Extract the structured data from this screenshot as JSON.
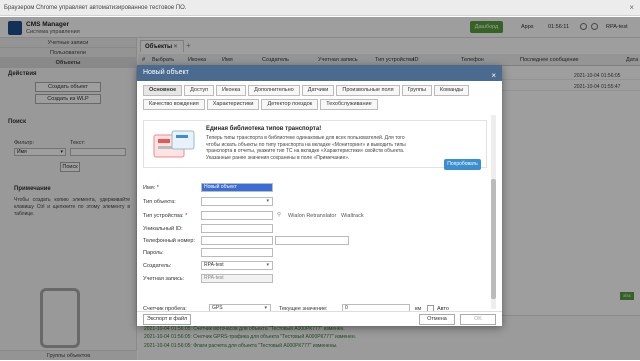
{
  "chrome_notice": "Браузером Chrome управляет автоматизированное тестовое ПО.",
  "app": {
    "title": "CMS Manager",
    "subtitle": "Система управления",
    "dashboard_btn": "Дашборд",
    "apps_label": "Apps",
    "time": "01:56:11",
    "user": "RPA-test"
  },
  "sidebar": {
    "tabs": [
      "Учетные записи",
      "Пользователи",
      "Объекты"
    ],
    "actions_title": "Действия",
    "create_object": "Создать объект",
    "create_from_wlp": "Создать из WLP",
    "search_title": "Поиск",
    "filter_label": "Фильтр:",
    "text_label": "Текст:",
    "filter_value": "Имя",
    "search_btn": "Поиск",
    "note_title": "Примечание",
    "note_text": "Чтобы создать копию элемента, удерживайте клавишу Ctrl и щелкните по этому элементу в таблице.",
    "bottom_label": "Группы объектов"
  },
  "main": {
    "tab": "Объекты",
    "columns": [
      "#",
      "Выбрать",
      "Иконка",
      "Имя",
      "Создатель",
      "Учетная запись",
      "Тип устройства",
      "ID",
      "Телефон",
      "Последнее сообщение",
      "Дата"
    ],
    "rows": [
      {
        "msg": "2021-10-04 01:56:05"
      },
      {
        "msg": "2021-10-04 01:55:47"
      }
    ],
    "green_btn": "xlsx",
    "log": [
      "2021-10-04 01:56:05: Счетчик пробега для объекта \"Тестовый А000РК777\" изменен.",
      "2021-10-04 01:56:05: Счетчик моточасов для объекта \"Тестовый А000РК777\" изменен.",
      "2021-10-04 01:56:05: Счетчик GPRS-трафика для объекта \"Тестовый А000РК777\" изменен.",
      "2021-10-04 01:56:05: Флаги расчета для объекта \"Тестовый А000РК777\" изменены."
    ]
  },
  "modal": {
    "title": "Новый объект",
    "tabs_row1": [
      "Основное",
      "Доступ",
      "Иконка",
      "Дополнительно",
      "Датчики",
      "Произвольные поля",
      "Группы",
      "Команды"
    ],
    "tabs_row2": [
      "Качество вождения",
      "Характеристики",
      "Детектор поездок",
      "Техобслуживание"
    ],
    "info_title": "Единая библиотека типов транспорта!",
    "info_text": "Теперь типы транспорта в библиотеке одинаковые для всех пользователей. Для того чтобы искать объекты по типу транспорта на вкладке «Мониторинг» и выводить типы транспорта в отчеты, укажите тип ТС на вкладке «Характеристики» свойств объекта. Указанные ранее значения сохранены в поле «Примечание».",
    "try_btn": "Попробовать",
    "labels": {
      "name": "Имя:",
      "object_type": "Тип объекта:",
      "device_type": "Тип устройства:",
      "unique_id": "Уникальный ID:",
      "phone": "Телефонный номер:",
      "password": "Пароль:",
      "creator": "Создатель:",
      "account": "Учетная запись:",
      "mileage": "Счетчик пробега:",
      "current_value": "Текущее значение:",
      "km": "км",
      "auto": "Авто"
    },
    "values": {
      "name": "Новый объект",
      "creator": "RPA-test",
      "account": "RPA-test",
      "mileage": "GPS",
      "current": "0"
    },
    "device_hints": [
      "Wialon Retranslator",
      "Wialtrack"
    ],
    "export_btn": "Экспорт в файл",
    "cancel_btn": "Отмена",
    "ok_btn": "OK"
  }
}
